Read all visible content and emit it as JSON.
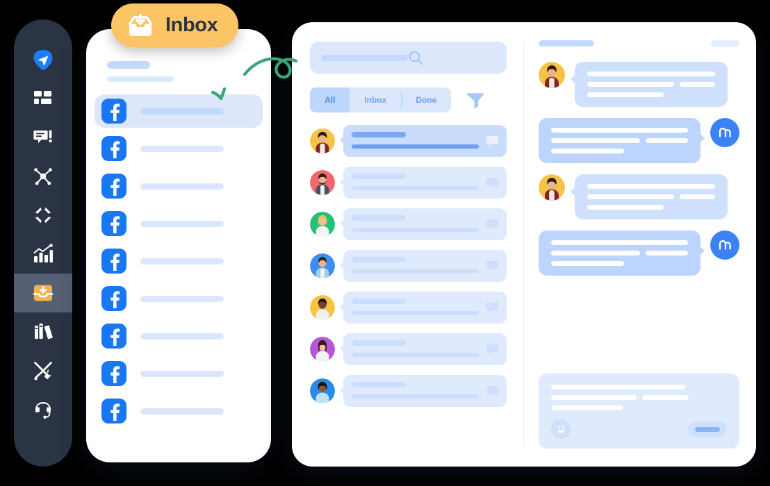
{
  "badge": {
    "label": "Inbox",
    "icon": "inbox-download-icon",
    "background": "#fbc565",
    "text_color": "#2e3440"
  },
  "arrow": {
    "name": "green-curved-arrow",
    "color": "#3aa675",
    "points_to": "first-channel-row"
  },
  "sidebar": {
    "background": "#2b3445",
    "active_background": "#566073",
    "items": [
      {
        "icon": "paper-plane-logo-icon",
        "active": false,
        "accent": "#1d7efd"
      },
      {
        "icon": "dashboard-grid-icon",
        "active": false
      },
      {
        "icon": "chat-alert-icon",
        "active": false
      },
      {
        "icon": "network-hub-icon",
        "active": false
      },
      {
        "icon": "automation-diamond-icon",
        "active": false
      },
      {
        "icon": "analytics-bar-chart-icon",
        "active": false
      },
      {
        "icon": "inbox-download-icon",
        "active": true,
        "accent": "#f0b44c"
      },
      {
        "icon": "library-books-icon",
        "active": false
      },
      {
        "icon": "tools-wrench-icon",
        "active": false
      },
      {
        "icon": "headset-support-icon",
        "active": false
      }
    ]
  },
  "channel_panel": {
    "header_bars": [
      {
        "width": 62,
        "color": "#c3d9fd"
      },
      {
        "width": 96,
        "color": "#dde9fd"
      }
    ],
    "rows": [
      {
        "icon": "facebook-icon",
        "selected": true,
        "line_width": 120
      },
      {
        "icon": "facebook-icon",
        "selected": false,
        "line_width": 120
      },
      {
        "icon": "facebook-icon",
        "selected": false,
        "line_width": 120
      },
      {
        "icon": "facebook-icon",
        "selected": false,
        "line_width": 120
      },
      {
        "icon": "facebook-icon",
        "selected": false,
        "line_width": 120
      },
      {
        "icon": "facebook-icon",
        "selected": false,
        "line_width": 120
      },
      {
        "icon": "facebook-icon",
        "selected": false,
        "line_width": 120
      },
      {
        "icon": "facebook-icon",
        "selected": false,
        "line_width": 120
      },
      {
        "icon": "facebook-icon",
        "selected": false,
        "line_width": 120
      }
    ]
  },
  "search": {
    "icon": "search-icon",
    "placeholder": "",
    "value": ""
  },
  "tabs": [
    {
      "label": "All",
      "active": true
    },
    {
      "label": "Inbox",
      "active": false
    },
    {
      "label": "Done",
      "active": false
    }
  ],
  "filter": {
    "icon": "filter-funnel-icon"
  },
  "conversations": [
    {
      "avatar_color": "#f7c346",
      "unread": true,
      "icon": "chat-bubble-icon"
    },
    {
      "avatar_color": "#f4666f",
      "unread": false,
      "icon": "chat-bubble-icon"
    },
    {
      "avatar_color": "#21c177",
      "unread": false,
      "icon": "chat-bubble-icon"
    },
    {
      "avatar_color": "#3d8ef0",
      "unread": false,
      "icon": "chat-bubble-icon"
    },
    {
      "avatar_color": "#f7c346",
      "unread": false,
      "icon": "chat-bubble-icon"
    },
    {
      "avatar_color": "#b557d6",
      "unread": false,
      "icon": "chat-bubble-icon"
    },
    {
      "avatar_color": "#2b8ae8",
      "unread": false,
      "icon": "chat-bubble-icon"
    }
  ],
  "chat": {
    "header": {
      "title_bar_width": 80,
      "action_bar_width": 41
    },
    "brand_avatar": {
      "icon": "brand-m-logo-icon",
      "color": "#3b82f6"
    },
    "messages": [
      {
        "direction": "in",
        "avatar_color": "#f7c346",
        "lines": [
          184,
          125,
          80,
          110
        ]
      },
      {
        "direction": "out",
        "avatar": "brand-m-logo-icon",
        "lines": [
          197,
          128,
          66,
          105
        ]
      },
      {
        "direction": "in",
        "avatar_color": "#f7c346",
        "lines": [
          184,
          125,
          80,
          110
        ]
      },
      {
        "direction": "out",
        "avatar": "brand-m-logo-icon",
        "lines": [
          197,
          128,
          66,
          105
        ]
      }
    ],
    "composer": {
      "emoji_icon": "smiley-face-icon",
      "send_icon": "send-button",
      "lines": [
        193,
        123,
        68,
        103
      ],
      "value": ""
    }
  },
  "theme": {
    "page_background": "#000000",
    "panel_background": "#ffffff",
    "accent_blue": "#3b82f6",
    "placeholder_blue": "#dce7fc",
    "placeholder_blue_strong": "#c3d9fd",
    "facebook_blue": "#1977f3",
    "tab_active_blue": "#bdd6fc",
    "tab_text_blue": "#6f9ff0"
  }
}
